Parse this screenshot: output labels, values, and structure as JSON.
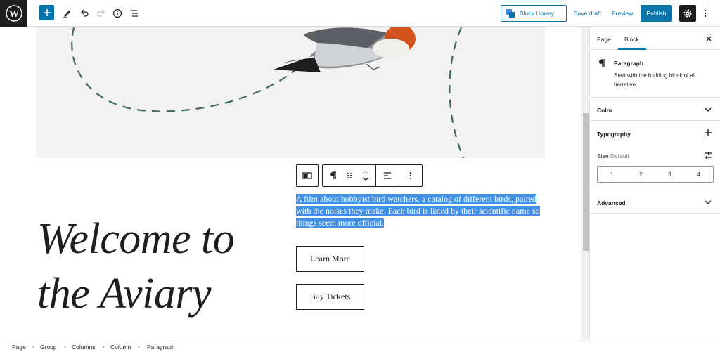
{
  "topbar": {
    "logo": "wordpress-logo",
    "tools": [
      "add-block-icon",
      "pen-tool-icon",
      "undo-icon",
      "redo-icon",
      "info-icon",
      "list-view-icon"
    ],
    "block_library_label": "Block Library",
    "save_draft_label": "Save draft",
    "preview_label": "Preview",
    "publish_label": "Publish",
    "colors": {
      "accent": "#0a74ad",
      "dark": "#1e1e1e"
    }
  },
  "canvas": {
    "heading_line1": "Welcome to",
    "heading_line2": "the Aviary",
    "paragraph": "A film about hobbyist bird watchers, a catalog of different birds, paired with the noises they make. Each bird is listed by their scientific name so things seem more official.",
    "selection_color": "#3f8fe4",
    "learn_more_label": "Learn More",
    "buy_tickets_label": "Buy Tickets"
  },
  "sidebar": {
    "tab_page": "Page",
    "tab_block": "Block",
    "block_name": "Paragraph",
    "block_description": "Start with the building block of all narrative.",
    "panel_color": "Color",
    "panel_typography": "Typography",
    "size_label": "Size",
    "size_value": "Default",
    "size_options": [
      "1",
      "2",
      "3",
      "4"
    ],
    "panel_advanced": "Advanced"
  },
  "breadcrumb": {
    "items": [
      "Page",
      "Group",
      "Columns",
      "Column",
      "Paragraph"
    ]
  }
}
